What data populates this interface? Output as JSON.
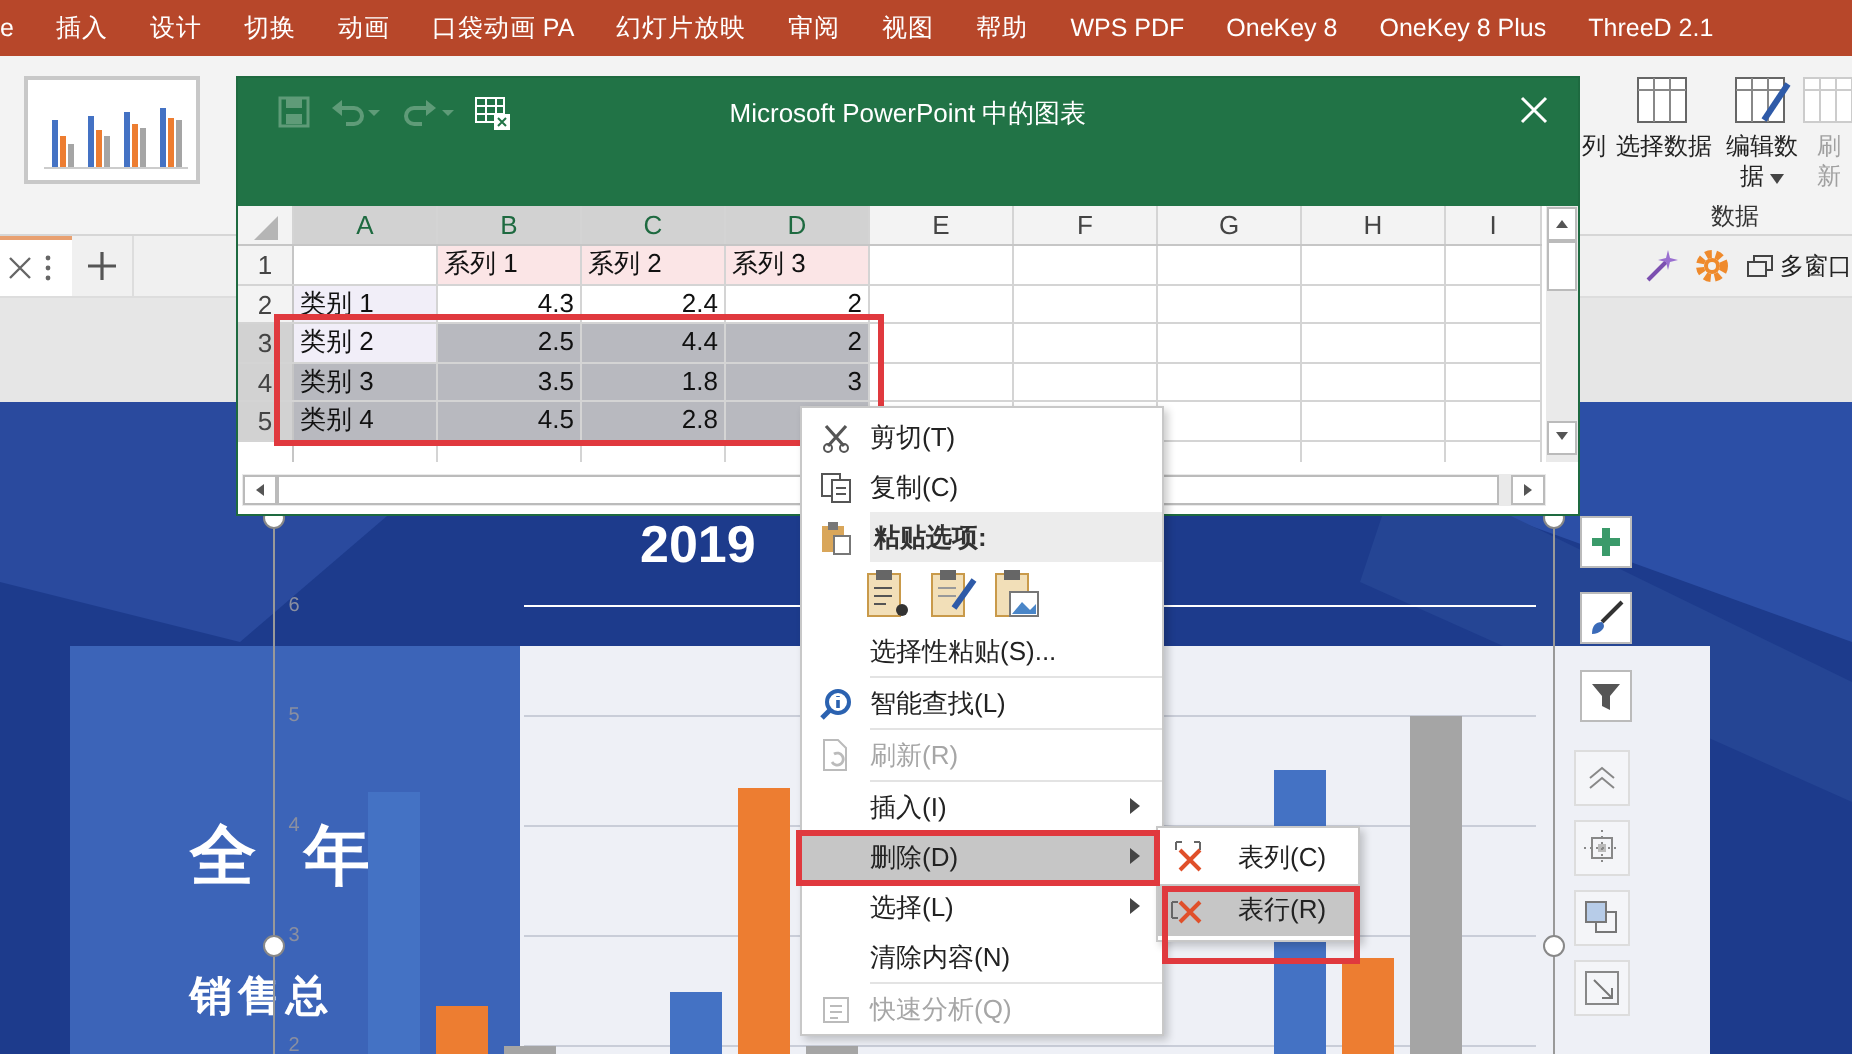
{
  "ribbon": {
    "tabs": [
      {
        "label": "e",
        "selected": false
      },
      {
        "label": "插入",
        "selected": false
      },
      {
        "label": "设计",
        "selected": false
      },
      {
        "label": "切换",
        "selected": false
      },
      {
        "label": "动画",
        "selected": false
      },
      {
        "label": "口袋动画 PA",
        "selected": false
      },
      {
        "label": "幻灯片放映",
        "selected": false
      },
      {
        "label": "审阅",
        "selected": false
      },
      {
        "label": "视图",
        "selected": false
      },
      {
        "label": "帮助",
        "selected": false
      },
      {
        "label": "WPS PDF",
        "selected": false
      },
      {
        "label": "OneKey 8",
        "selected": false
      },
      {
        "label": "OneKey 8 Plus",
        "selected": false
      },
      {
        "label": "ThreeD 2.1",
        "selected": false
      }
    ],
    "data_group": {
      "label": "数据",
      "buttons": [
        {
          "label": "列",
          "disabled": false,
          "dropdown": false
        },
        {
          "label": "选择数据",
          "disabled": false,
          "dropdown": false
        },
        {
          "label": "编辑数据",
          "disabled": false,
          "dropdown": true
        },
        {
          "label": "刷新",
          "disabled": true,
          "dropdown": false
        }
      ]
    },
    "window_button": {
      "label": "多窗口"
    }
  },
  "spreadsheet": {
    "title": "Microsoft PowerPoint 中的图表",
    "columns": [
      {
        "label": "A",
        "selected": true
      },
      {
        "label": "B",
        "selected": true
      },
      {
        "label": "C",
        "selected": true
      },
      {
        "label": "D",
        "selected": true
      },
      {
        "label": "E",
        "selected": false
      },
      {
        "label": "F",
        "selected": false
      },
      {
        "label": "G",
        "selected": false
      },
      {
        "label": "H",
        "selected": false
      },
      {
        "label": "I",
        "selected": false
      }
    ],
    "rows": [
      {
        "number": "1",
        "kind": "header",
        "selected": false,
        "values": [
          "系列 1",
          "系列 2",
          "系列 3"
        ]
      },
      {
        "number": "2",
        "kind": "data",
        "selected": false,
        "label": "类别 1",
        "values": [
          "4.3",
          "2.4",
          "2"
        ]
      },
      {
        "number": "3",
        "kind": "data",
        "selected": true,
        "label": "类别 2",
        "values": [
          "2.5",
          "4.4",
          "2"
        ]
      },
      {
        "number": "4",
        "kind": "data",
        "selected": true,
        "label": "类别 3",
        "values": [
          "3.5",
          "1.8",
          "3"
        ]
      },
      {
        "number": "5",
        "kind": "data",
        "selected": true,
        "label": "类别 4",
        "values": [
          "4.5",
          "2.8"
        ]
      }
    ]
  },
  "slide": {
    "title": "2019",
    "heading": [
      "全",
      "年"
    ],
    "subheading": "销售总",
    "axis_labels": [
      "6",
      "5",
      "4",
      "3",
      "2"
    ]
  },
  "context_menu": {
    "items": [
      {
        "kind": "item",
        "label": "剪切(T)",
        "disabled": false,
        "selected": false
      },
      {
        "kind": "item",
        "label": "复制(C)",
        "disabled": false,
        "selected": false
      },
      {
        "kind": "header",
        "label": "粘贴选项:"
      },
      {
        "kind": "paste-icons"
      },
      {
        "kind": "item",
        "label": "选择性粘贴(S)...",
        "disabled": false,
        "selected": false
      },
      {
        "kind": "separator"
      },
      {
        "kind": "item",
        "label": "智能查找(L)",
        "disabled": false,
        "selected": false
      },
      {
        "kind": "separator"
      },
      {
        "kind": "item",
        "label": "刷新(R)",
        "disabled": true,
        "selected": false
      },
      {
        "kind": "separator"
      },
      {
        "kind": "submenu",
        "label": "插入(I)",
        "disabled": false,
        "selected": false
      },
      {
        "kind": "submenu",
        "label": "删除(D)",
        "disabled": false,
        "selected": true
      },
      {
        "kind": "submenu",
        "label": "选择(L)",
        "disabled": false,
        "selected": false
      },
      {
        "kind": "item",
        "label": "清除内容(N)",
        "disabled": false,
        "selected": false
      },
      {
        "kind": "separator"
      },
      {
        "kind": "item",
        "label": "快速分析(Q)",
        "disabled": true,
        "selected": false
      }
    ]
  },
  "submenu": {
    "items": [
      {
        "label": "表列(C)",
        "selected": false
      },
      {
        "label": "表行(R)",
        "selected": true
      }
    ]
  }
}
